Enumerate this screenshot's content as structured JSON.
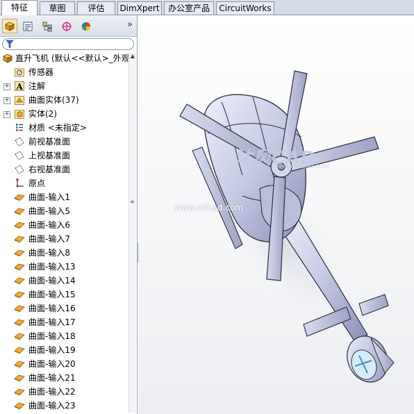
{
  "tabs": [
    {
      "label": "特征",
      "active": true
    },
    {
      "label": "草图",
      "active": false
    },
    {
      "label": "评估",
      "active": false
    },
    {
      "label": "DimXpert",
      "active": false
    },
    {
      "label": "办公室产品",
      "active": false
    },
    {
      "label": "CircuitWorks",
      "active": false
    }
  ],
  "toolbar": {
    "icons": [
      "feature-manager-icon",
      "property-manager-icon",
      "configuration-manager-icon",
      "dimxpert-manager-icon",
      "display-manager-icon"
    ],
    "more": "»"
  },
  "tree": {
    "root": {
      "label": "直升飞机 (默认<<默认>_外观",
      "icon": "part-icon"
    },
    "items": [
      {
        "label": "传感器",
        "icon": "sensor-folder-icon",
        "expander": ""
      },
      {
        "label": "注解",
        "icon": "annotation-icon",
        "expander": "+"
      },
      {
        "label": "曲面实体(37)",
        "icon": "surface-bodies-folder-icon",
        "expander": "+"
      },
      {
        "label": "实体(2)",
        "icon": "solid-bodies-folder-icon",
        "expander": "+"
      },
      {
        "label": "材质 <未指定>",
        "icon": "material-icon",
        "expander": ""
      },
      {
        "label": "前视基准面",
        "icon": "plane-icon",
        "expander": ""
      },
      {
        "label": "上视基准面",
        "icon": "plane-icon",
        "expander": ""
      },
      {
        "label": "右视基准面",
        "icon": "plane-icon",
        "expander": ""
      },
      {
        "label": "原点",
        "icon": "origin-icon",
        "expander": ""
      },
      {
        "label": "曲面-输入1",
        "icon": "imported-surface-icon",
        "expander": ""
      },
      {
        "label": "曲面-输入5",
        "icon": "imported-surface-icon",
        "expander": ""
      },
      {
        "label": "曲面-输入6",
        "icon": "imported-surface-icon",
        "expander": ""
      },
      {
        "label": "曲面-输入7",
        "icon": "imported-surface-icon",
        "expander": ""
      },
      {
        "label": "曲面-输入8",
        "icon": "imported-surface-icon",
        "expander": ""
      },
      {
        "label": "曲面-输入13",
        "icon": "imported-surface-icon",
        "expander": ""
      },
      {
        "label": "曲面-输入14",
        "icon": "imported-surface-icon",
        "expander": ""
      },
      {
        "label": "曲面-输入15",
        "icon": "imported-surface-icon",
        "expander": ""
      },
      {
        "label": "曲面-输入16",
        "icon": "imported-surface-icon",
        "expander": ""
      },
      {
        "label": "曲面-输入17",
        "icon": "imported-surface-icon",
        "expander": ""
      },
      {
        "label": "曲面-输入18",
        "icon": "imported-surface-icon",
        "expander": ""
      },
      {
        "label": "曲面-输入19",
        "icon": "imported-surface-icon",
        "expander": ""
      },
      {
        "label": "曲面-输入20",
        "icon": "imported-surface-icon",
        "expander": ""
      },
      {
        "label": "曲面-输入21",
        "icon": "imported-surface-icon",
        "expander": ""
      },
      {
        "label": "曲面-输入22",
        "icon": "imported-surface-icon",
        "expander": ""
      },
      {
        "label": "曲面-输入23",
        "icon": "imported-surface-icon",
        "expander": ""
      }
    ]
  },
  "viewport": {
    "watermark_brand": "沐风CAD",
    "watermark_small": "www.mfcad.com",
    "watermark_url": "www.mfcad.com"
  },
  "colors": {
    "model_body": "#c7cbe3",
    "model_edge": "#2a2d3e",
    "active_tab_bg": "#ffffff",
    "tree_surface_icon": "#f2a93b"
  }
}
